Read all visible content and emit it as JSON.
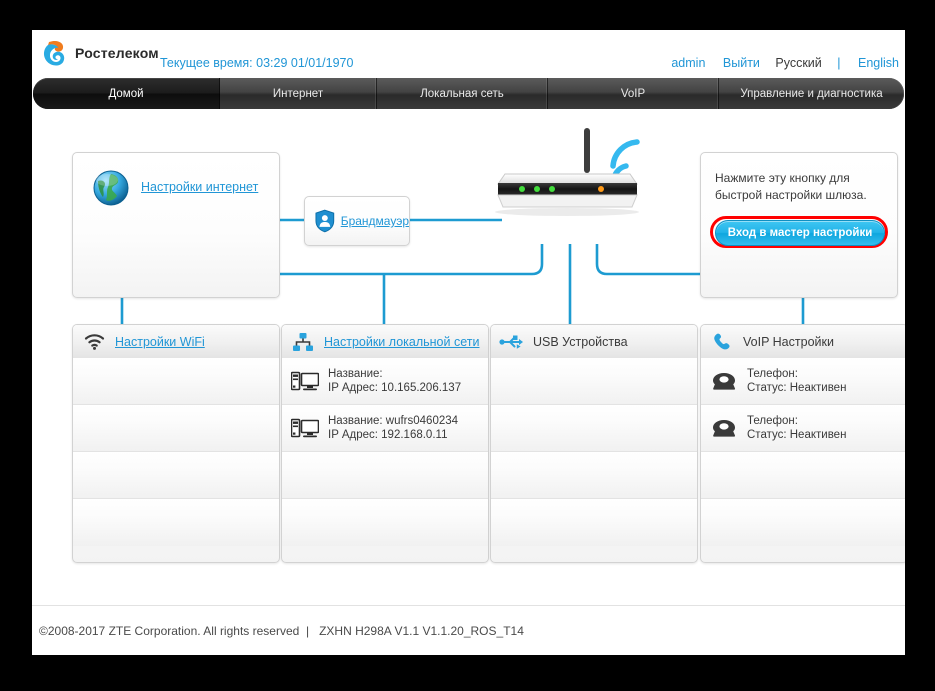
{
  "brand": {
    "name": "Ростелеком",
    "logo_icon": "rostelecom-logo-icon"
  },
  "header": {
    "current_time": "Текущее время: 03:29 01/01/1970",
    "user": "admin",
    "logout": "Выйти",
    "lang_ru": "Русский",
    "lang_sep": "|",
    "lang_en": "English"
  },
  "nav": {
    "tabs": [
      {
        "label": "Домой",
        "active": true
      },
      {
        "label": "Интернет",
        "active": false
      },
      {
        "label": "Локальная сеть",
        "active": false
      },
      {
        "label": "VoIP",
        "active": false
      },
      {
        "label": "Управление и диагностика",
        "active": false
      }
    ]
  },
  "topology": {
    "internet": {
      "label": "Настройки интернет",
      "icon": "globe-icon"
    },
    "firewall": {
      "label": "Брандмауэр",
      "icon": "shield-user-icon"
    },
    "router": {
      "icon": "router-icon",
      "wifi_icon": "wifi-waves-icon"
    },
    "wizard": {
      "text": "Нажмите эту кнопку для быстрой настройки шлюза.",
      "button": "Вход в мастер настройки",
      "ring_color": "#ff0000",
      "button_color": "#21b3e8"
    }
  },
  "panels": [
    {
      "title": "Настройки WiFi",
      "icon": "wifi-icon",
      "title_is_link": true,
      "rows": [
        {
          "icon": "",
          "line1": "",
          "line2": ""
        },
        {
          "icon": "",
          "line1": "",
          "line2": ""
        },
        {
          "icon": "",
          "line1": "",
          "line2": ""
        },
        {
          "icon": "",
          "line1": "",
          "line2": ""
        }
      ]
    },
    {
      "title": "Настройки локальной сети",
      "icon": "lan-icon",
      "title_is_link": true,
      "rows": [
        {
          "icon": "computer-icon",
          "line1": "Название:",
          "line2": "IP Адрес: 10.165.206.137"
        },
        {
          "icon": "computer-icon",
          "line1": "Название: wufrs0460234",
          "line2": "IP Адрес: 192.168.0.11"
        },
        {
          "icon": "",
          "line1": "",
          "line2": ""
        },
        {
          "icon": "",
          "line1": "",
          "line2": ""
        }
      ]
    },
    {
      "title": "USB Устройства",
      "icon": "usb-icon",
      "title_is_link": false,
      "rows": [
        {
          "icon": "",
          "line1": "",
          "line2": ""
        },
        {
          "icon": "",
          "line1": "",
          "line2": ""
        },
        {
          "icon": "",
          "line1": "",
          "line2": ""
        },
        {
          "icon": "",
          "line1": "",
          "line2": ""
        }
      ]
    },
    {
      "title": "VoIP Настройки",
      "icon": "phone-handset-icon",
      "title_is_link": false,
      "rows": [
        {
          "icon": "telephone-icon",
          "line1": "Телефон:",
          "line2": "Статус: Неактивен"
        },
        {
          "icon": "telephone-icon",
          "line1": "Телефон:",
          "line2": "Статус: Неактивен"
        },
        {
          "icon": "",
          "line1": "",
          "line2": ""
        },
        {
          "icon": "",
          "line1": "",
          "line2": ""
        }
      ]
    }
  ],
  "footer": {
    "copyright": "©2008-2017 ZTE Corporation. All rights reserved  |   ZXHN H298A V1.1 V1.1.20_ROS_T14"
  }
}
